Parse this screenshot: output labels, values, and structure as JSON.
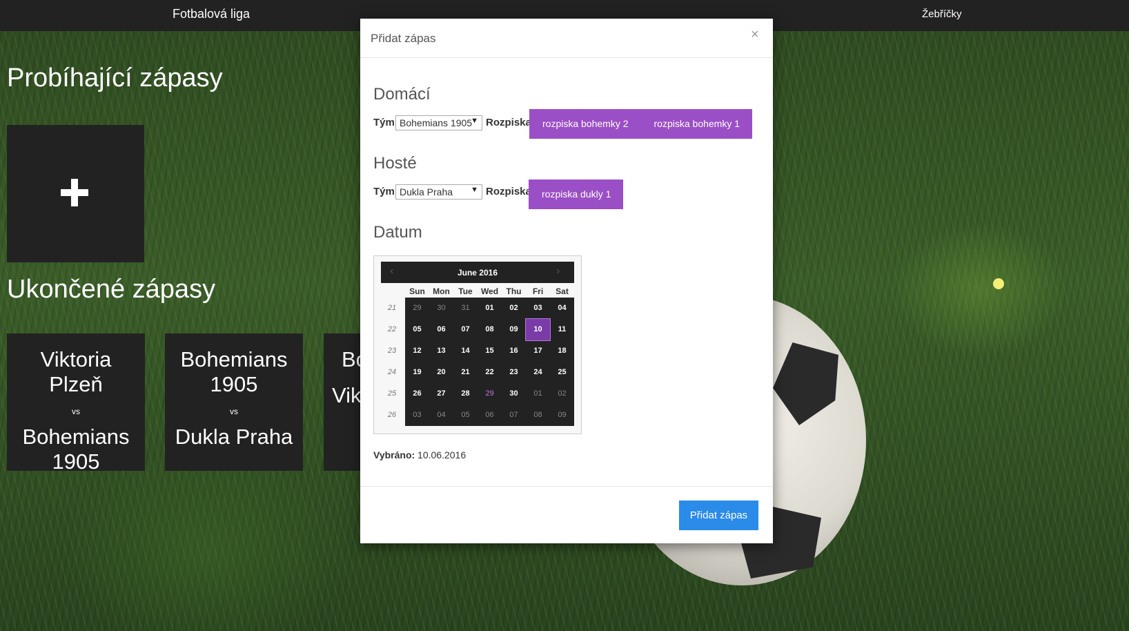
{
  "navbar": {
    "brand": "Fotbalová liga",
    "right_link": "Žebříčky"
  },
  "main": {
    "running_title": "Probíhající zápasy",
    "finished_title": "Ukončené zápasy",
    "matches": [
      {
        "home": "Viktoria Plzeň",
        "vs": "vs",
        "away": "Bohemians 1905"
      },
      {
        "home": "Bohemians 1905",
        "vs": "vs",
        "away": "Dukla Praha"
      },
      {
        "home": "Bo",
        "vs": "",
        "away": "Vikt"
      }
    ]
  },
  "modal": {
    "title": "Přidat zápas",
    "close": "×",
    "home_section": "Domácí",
    "away_section": "Hosté",
    "date_section": "Datum",
    "team_label": "Tým",
    "lineup_label": "Rozpiska",
    "home_team": "Bohemians 1905",
    "away_team": "Dukla Praha",
    "home_lineups": [
      "rozpiska bohemky 2",
      "rozpiska bohemky 1"
    ],
    "away_lineups": [
      "rozpiska dukly 1"
    ],
    "selected_label": "Vybráno:",
    "selected_value": "10.06.2016",
    "submit": "Přidat zápas"
  },
  "datepicker": {
    "month": "June 2016",
    "prev": "‹",
    "next": "›",
    "weekdays": [
      "Sun",
      "Mon",
      "Tue",
      "Wed",
      "Thu",
      "Fri",
      "Sat"
    ],
    "weeks": [
      "21",
      "22",
      "23",
      "24",
      "25",
      "26"
    ],
    "days": [
      [
        "29",
        "30",
        "31",
        "01",
        "02",
        "03",
        "04"
      ],
      [
        "05",
        "06",
        "07",
        "08",
        "09",
        "10",
        "11"
      ],
      [
        "12",
        "13",
        "14",
        "15",
        "16",
        "17",
        "18"
      ],
      [
        "19",
        "20",
        "21",
        "22",
        "23",
        "24",
        "25"
      ],
      [
        "26",
        "27",
        "28",
        "29",
        "30",
        "01",
        "02"
      ],
      [
        "03",
        "04",
        "05",
        "06",
        "07",
        "08",
        "09"
      ]
    ],
    "selected": "10",
    "today": "29"
  },
  "colors": {
    "accent": "#9b4fc6",
    "primary": "#2a8be8",
    "dark": "#222222"
  },
  "icons": {
    "add": "plus-icon",
    "close": "close-icon"
  }
}
